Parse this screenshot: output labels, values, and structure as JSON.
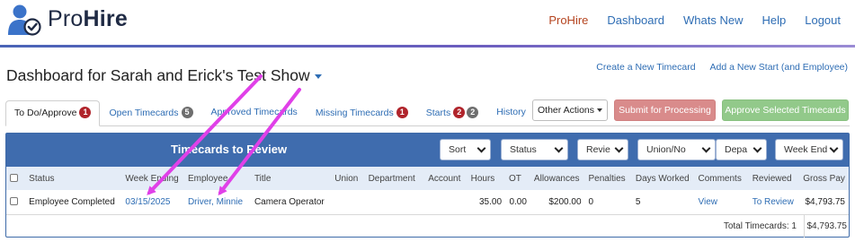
{
  "app": {
    "brand_light": "Pro",
    "brand_bold": "Hire",
    "nav": [
      {
        "label": "ProHire",
        "active": true
      },
      {
        "label": "Dashboard",
        "active": false
      },
      {
        "label": "Whats New",
        "active": false
      },
      {
        "label": "Help",
        "active": false
      },
      {
        "label": "Logout",
        "active": false
      }
    ],
    "logo_icon": "person-check-icon",
    "accent": "#2e6db4",
    "brand_color": "#b5441f"
  },
  "header": {
    "title": "Dashboard for Sarah and Erick's Test Show",
    "links": [
      "Create a New Timecard",
      "Add a New Start (and Employee)"
    ]
  },
  "tabs": [
    {
      "label": "To Do/Approve",
      "badges": [
        {
          "value": "1",
          "color": "red"
        }
      ],
      "active": true
    },
    {
      "label": "Open Timecards",
      "badges": [
        {
          "value": "5",
          "color": "gray"
        }
      ],
      "active": false
    },
    {
      "label": "Approved Timecards",
      "badges": [],
      "active": false
    },
    {
      "label": "Missing Timecards",
      "badges": [
        {
          "value": "1",
          "color": "red"
        }
      ],
      "active": false
    },
    {
      "label": "Starts",
      "badges": [
        {
          "value": "2",
          "color": "red"
        },
        {
          "value": "2",
          "color": "gray"
        }
      ],
      "active": false
    },
    {
      "label": "History",
      "badges": [],
      "active": false
    }
  ],
  "actions": {
    "other": "Other Actions",
    "submit": "Submit for Processing",
    "approve": "Approve Selected Timecards"
  },
  "panel": {
    "title": "Timecards to Review",
    "filters": [
      "Sort",
      "Status",
      "Revie",
      "Union/No",
      "Depa",
      "Week End"
    ]
  },
  "table": {
    "columns": [
      "Status",
      "Week Ending",
      "Employee",
      "Title",
      "Union",
      "Department",
      "Account",
      "Hours",
      "OT",
      "Allowances",
      "Penalties",
      "Days Worked",
      "Comments",
      "Reviewed",
      "Gross Pay"
    ],
    "rows": [
      {
        "status": "Employee Completed",
        "week_ending": "03/15/2025",
        "employee": "Driver, Minnie",
        "title": "Camera Operator",
        "union": "",
        "department": "",
        "account": "",
        "hours": "35.00",
        "ot": "0.00",
        "allowances": "$200.00",
        "penalties": "0",
        "days_worked": "5",
        "comments": "View",
        "reviewed": "To Review",
        "gross_pay": "$4,793.75"
      }
    ],
    "total_label": "Total Timecards: 1",
    "total_value": "$4,793.75"
  },
  "annotation_color": "#e040e8"
}
